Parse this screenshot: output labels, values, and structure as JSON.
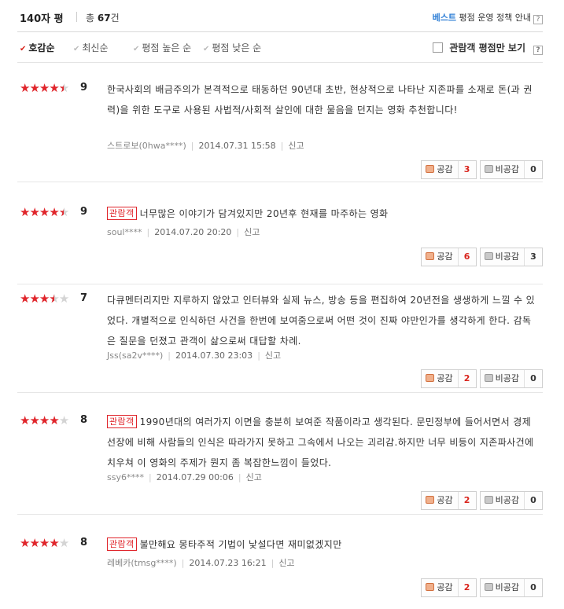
{
  "header": {
    "title": "140자 평",
    "total_prefix": "총",
    "total_count": "67",
    "total_suffix": "건",
    "policy_best": "베스트",
    "policy_rest": "평점 운영 정책 안내",
    "help": "?"
  },
  "sort": {
    "items": [
      {
        "label": "호감순",
        "active": true
      },
      {
        "label": "최신순",
        "active": false
      },
      {
        "label": "평점 높은 순",
        "active": false
      },
      {
        "label": "평점 낮은 순",
        "active": false
      }
    ],
    "audience_only": "관람객 평점만 보기",
    "audience_checked": false,
    "help": "?"
  },
  "labels": {
    "like": "공감",
    "dislike": "비공감",
    "report": "신고",
    "badge": "관람객"
  },
  "colors": {
    "star": "#e0252b",
    "star_empty": "#d4d4d4",
    "accent": "#2f7fd6",
    "badge": "#e0252b"
  },
  "reviews": [
    {
      "rating": 4.5,
      "score": "9",
      "badge": false,
      "text": "한국사회의 배금주의가 본격적으로 태동하던 90년대 초반, 현상적으로 나타난 지존파를 소재로 돈(과 권력)을 위한 도구로 사용된 사법적/사회적 살인에 대한 물음을 던지는 영화 추천합니다!",
      "author": "스트로보(0hwa****)",
      "date": "2014.07.31 15:58",
      "likes": "3",
      "dislikes": "0"
    },
    {
      "rating": 4.5,
      "score": "9",
      "badge": true,
      "text": "너무많은 이야기가 담겨있지만 20년후 현재를 마주하는 영화",
      "author": "soul****",
      "date": "2014.07.20 20:20",
      "likes": "6",
      "dislikes": "3"
    },
    {
      "rating": 3.5,
      "score": "7",
      "badge": false,
      "text": "다큐멘터리지만 지루하지 않았고 인터뷰와 실제 뉴스, 방송 등을 편집하여 20년전을 생생하게 느낄 수 있었다. 개별적으로 인식하던 사건을 한번에 보여줌으로써 어떤 것이 진짜 야만인가를 생각하게 한다. 감독은 질문을 던졌고 관객이 삶으로써 대답할 차례.",
      "author": "Jss(sa2v****)",
      "date": "2014.07.30 23:03",
      "likes": "2",
      "dislikes": "0"
    },
    {
      "rating": 4,
      "score": "8",
      "badge": true,
      "text": "1990년대의 여러가지 이면을 충분히 보여준 작품이라고 생각된다. 문민정부에 들어서면서 경제선장에 비해 사람들의 인식은 따라가지 못하고 그속에서 나오는 괴리감.하지만 너무 비등이 지존파사건에 치우쳐 이 영화의 주제가 뭔지 좀 복잡한느낌이 들었다.",
      "author": "ssy6****",
      "date": "2014.07.29 00:06",
      "likes": "2",
      "dislikes": "0"
    },
    {
      "rating": 4,
      "score": "8",
      "badge": true,
      "text": "불만해요 몽타주적 기법이 낯설다면 재미없겠지만",
      "author": "레베카(tmsg****)",
      "date": "2014.07.23 16:21",
      "likes": "2",
      "dislikes": "0"
    }
  ]
}
